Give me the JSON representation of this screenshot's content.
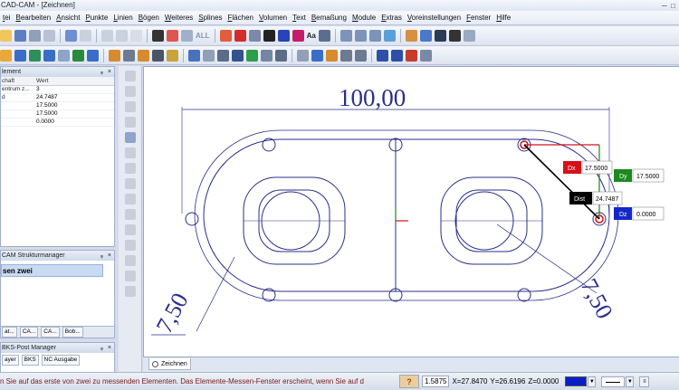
{
  "window": {
    "title": "CAD-CAM - [Zeichnen]"
  },
  "menu": [
    "tei",
    "Bearbeiten",
    "Ansicht",
    "Punkte",
    "Linien",
    "Bögen",
    "Weiteres",
    "Splines",
    "Flächen",
    "Volumen",
    "Text",
    "Bemaßung",
    "Module",
    "Extras",
    "Voreinstellungen",
    "Fenster",
    "Hilfe"
  ],
  "toolbar": {
    "all_label": "ALL",
    "text_label": "Aa"
  },
  "properties_panel": {
    "title": "lement",
    "headers": {
      "key": "chaft",
      "value": "Wert"
    },
    "rows": [
      {
        "key": "entrum z...",
        "value": "3"
      },
      {
        "key": "d",
        "value": "24.7487"
      },
      {
        "key": "",
        "value": "17.5000"
      },
      {
        "key": "",
        "value": "17.5000"
      },
      {
        "key": "",
        "value": "0.0000"
      }
    ]
  },
  "structure_panel": {
    "title": "CAM Strukturmanager",
    "selected_item": "sen zwei",
    "tabs": [
      "at...",
      "CA...",
      "CA...",
      "Bob..."
    ]
  },
  "post_panel": {
    "title": "BKS-Post Manager",
    "tabs": [
      "ayer",
      "BKS",
      "NC Ausgabe"
    ]
  },
  "drawing": {
    "dim_top": "100,00",
    "dim_left": "7,50",
    "dim_right": "7,50",
    "measure": {
      "dx_label": "Dx",
      "dx_value": "17.5000",
      "dy_label": "Dy",
      "dy_value": "17.5000",
      "dist_label": "Dist",
      "dist_value": "24.7487",
      "dz_label": "Dz",
      "dz_value": "0.0000"
    },
    "colors": {
      "outline": "#2a2f8a",
      "dx": "#d4101a",
      "dy": "#1c8a1c",
      "dist": "#000000",
      "dz": "#1428c8"
    }
  },
  "drawing_tab": "Zeichnen",
  "status": {
    "message": "n Sie auf das erste von zwei zu messenden Elementen. Das Elemente-Messen-Fenster erscheint, wenn Sie auf d",
    "value": "1.5875",
    "x": "X=27.8470",
    "y": "Y=26.6196",
    "z": "Z=0.0000"
  }
}
